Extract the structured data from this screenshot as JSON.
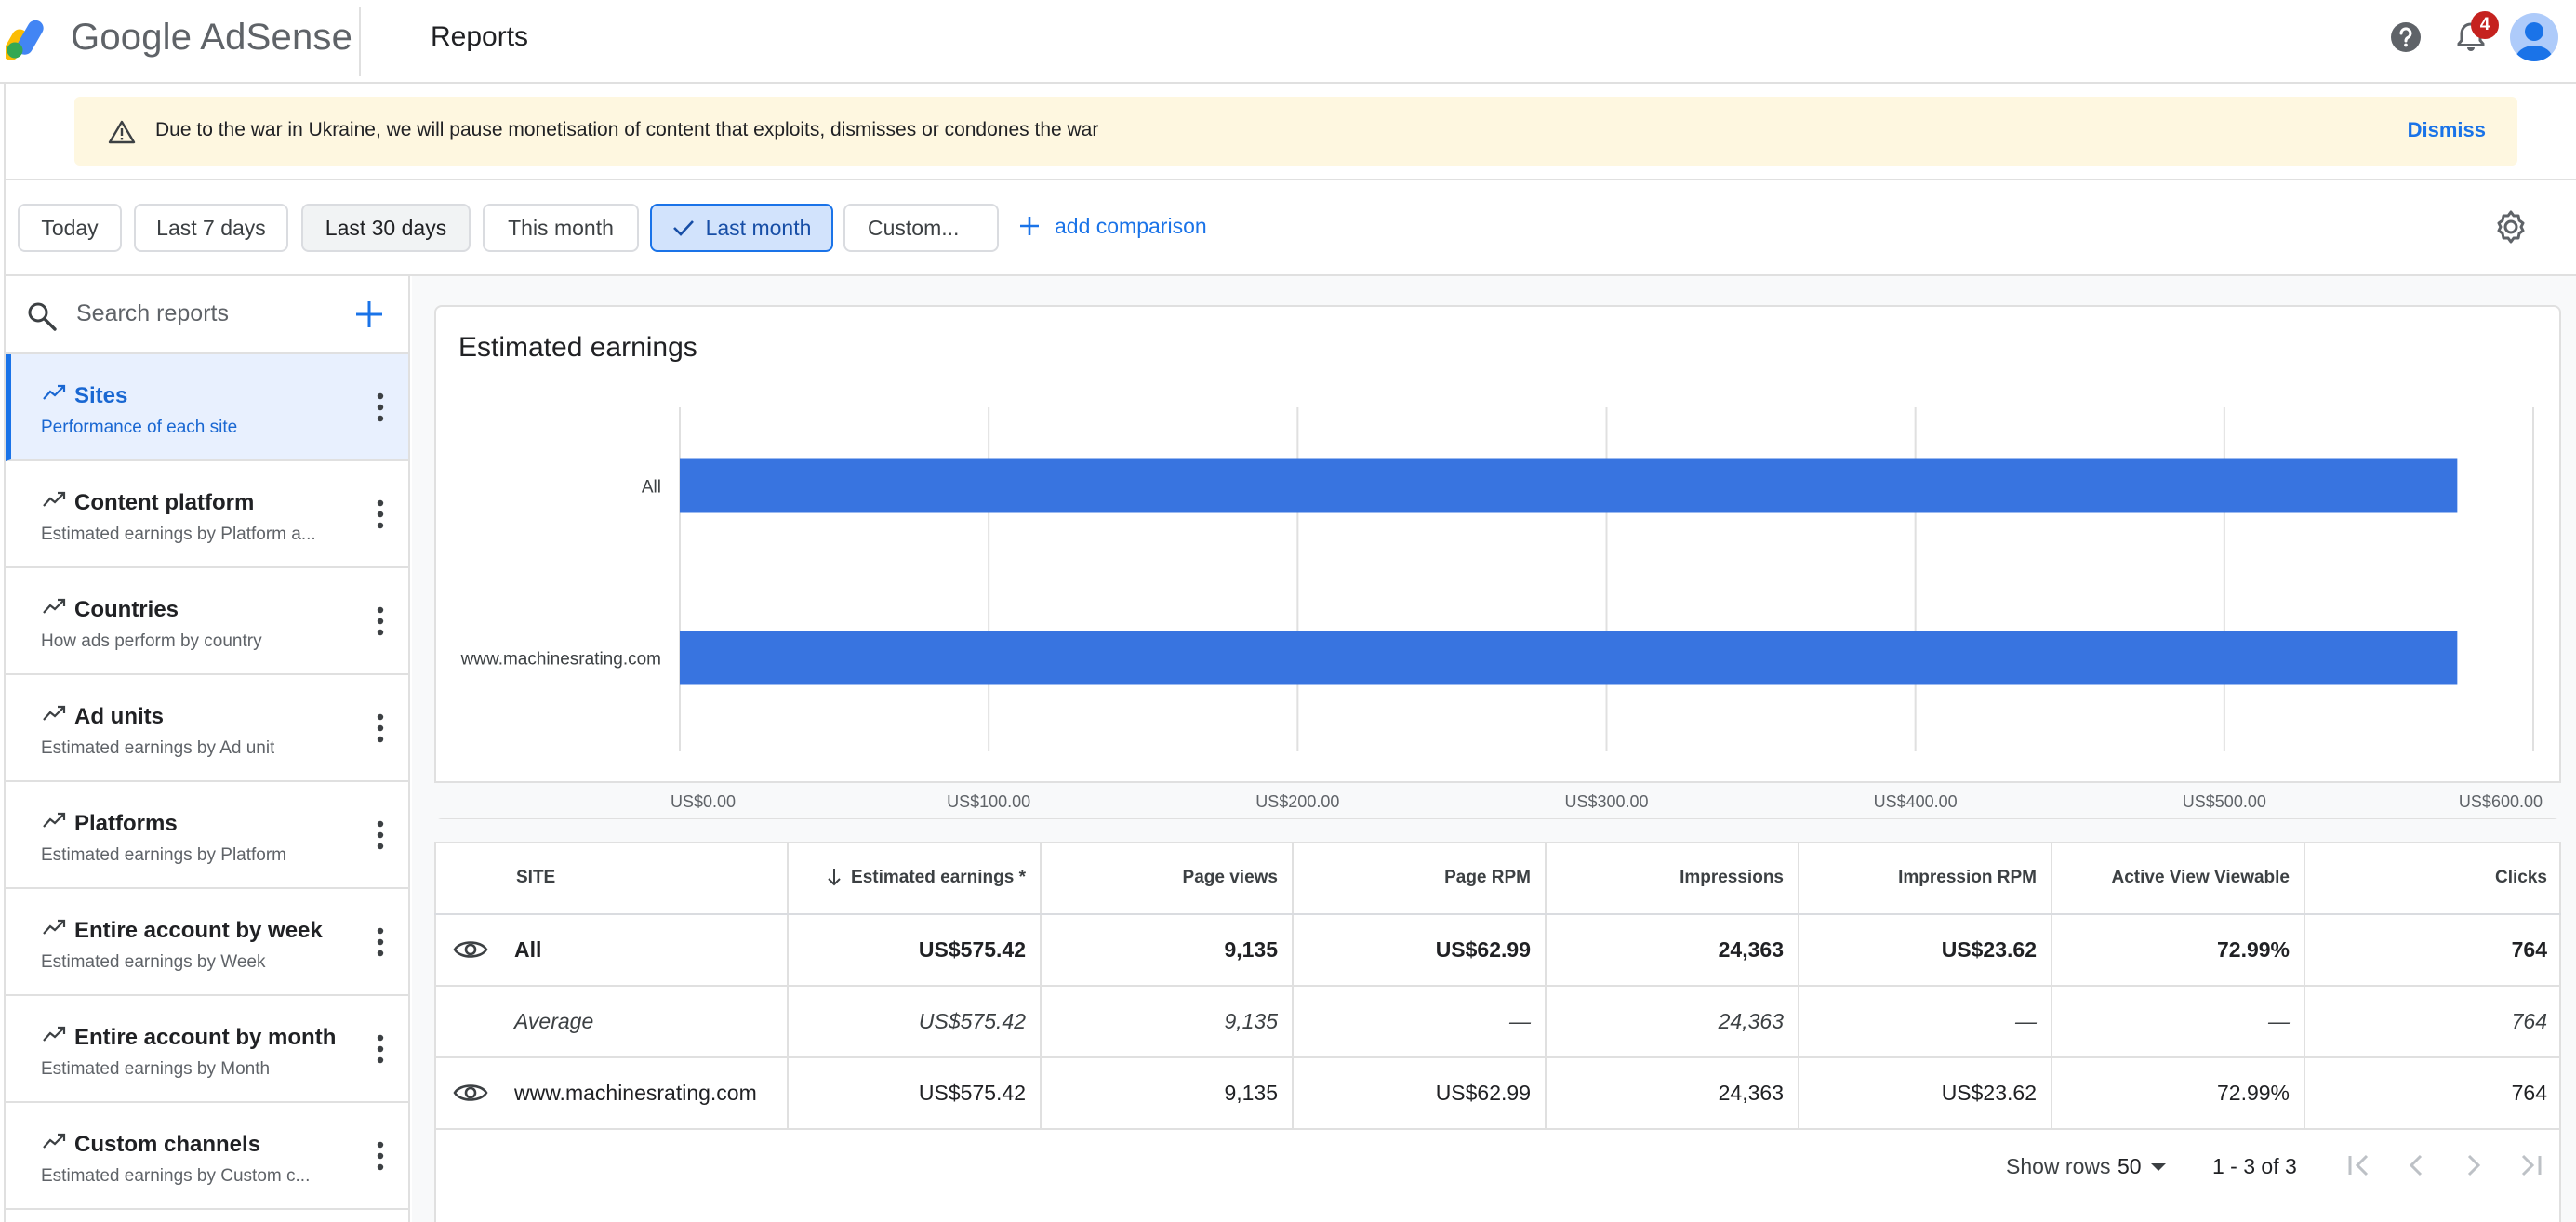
{
  "app": {
    "brand": "Google AdSense",
    "page_title": "Reports",
    "notification_count": "4"
  },
  "banner": {
    "message": "Due to the war in Ukraine, we will pause monetisation of content that exploits, dismisses or condones the war",
    "dismiss_label": "Dismiss"
  },
  "date_filters": {
    "today": "Today",
    "last7": "Last 7 days",
    "last30": "Last 30 days",
    "this_month": "This month",
    "last_month": "Last month",
    "custom": "Custom...",
    "selected": "Last month",
    "add_comparison": "add comparison"
  },
  "sidebar": {
    "search_placeholder": "Search reports",
    "items": [
      {
        "title": "Sites",
        "subtitle": "Performance of each site"
      },
      {
        "title": "Content platform",
        "subtitle": "Estimated earnings by Platform a..."
      },
      {
        "title": "Countries",
        "subtitle": "How ads perform by country"
      },
      {
        "title": "Ad units",
        "subtitle": "Estimated earnings by Ad unit"
      },
      {
        "title": "Platforms",
        "subtitle": "Estimated earnings by Platform"
      },
      {
        "title": "Entire account by week",
        "subtitle": "Estimated earnings by Week"
      },
      {
        "title": "Entire account by month",
        "subtitle": "Estimated earnings by Month"
      },
      {
        "title": "Custom channels",
        "subtitle": "Estimated earnings by Custom c..."
      }
    ]
  },
  "chart": {
    "title": "Estimated earnings"
  },
  "chart_data": {
    "type": "bar",
    "orientation": "horizontal",
    "title": "Estimated earnings",
    "categories": [
      "All",
      "www.machinesrating.com"
    ],
    "values": [
      575.42,
      575.42
    ],
    "xlim": [
      0,
      600
    ],
    "x_ticks": [
      0,
      100,
      200,
      300,
      400,
      500,
      600
    ],
    "x_tick_labels": [
      "US$0.00",
      "US$100.00",
      "US$200.00",
      "US$300.00",
      "US$400.00",
      "US$500.00",
      "US$600.00"
    ],
    "grid": true,
    "bar_color": "#3874e0"
  },
  "table": {
    "headers": [
      "SITE",
      "Estimated earnings *",
      "Page views",
      "Page RPM",
      "Impressions",
      "Impression RPM",
      "Active View Viewable",
      "Clicks"
    ],
    "rows": [
      {
        "site": "All",
        "earnings": "US$575.42",
        "page_views": "9,135",
        "page_rpm": "US$62.99",
        "impressions": "24,363",
        "impression_rpm": "US$23.62",
        "viewable": "72.99%",
        "clicks": "764"
      },
      {
        "site": "Average",
        "earnings": "US$575.42",
        "page_views": "9,135",
        "page_rpm": "—",
        "impressions": "24,363",
        "impression_rpm": "—",
        "viewable": "—",
        "clicks": "764"
      },
      {
        "site": "www.machinesrating.com",
        "earnings": "US$575.42",
        "page_views": "9,135",
        "page_rpm": "US$62.99",
        "impressions": "24,363",
        "impression_rpm": "US$23.62",
        "viewable": "72.99%",
        "clicks": "764"
      }
    ]
  },
  "pagination": {
    "show_rows_label": "Show rows",
    "rows_value": "50",
    "range": "1 - 3 of 3"
  },
  "colors": {
    "accent": "#1a73e8",
    "bar": "#3874e0",
    "banner_bg": "#fef7e0",
    "badge": "#c5221f"
  }
}
